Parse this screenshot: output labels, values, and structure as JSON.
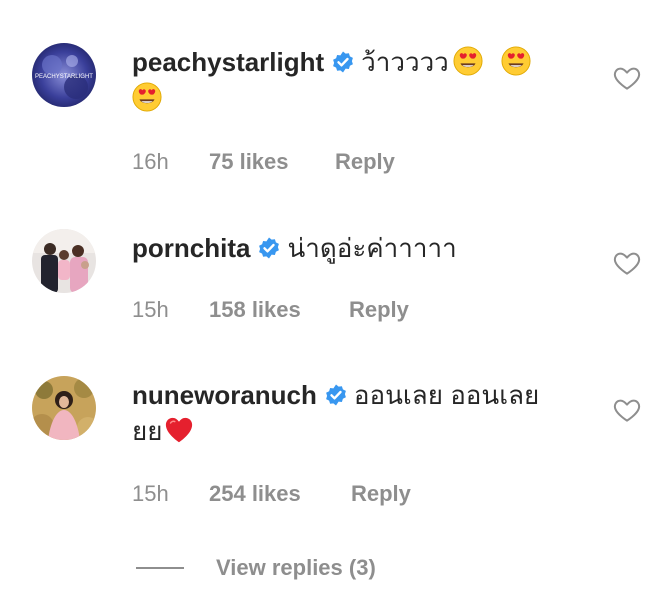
{
  "comments": [
    {
      "username": "peachystarlight",
      "text": "ว้าวววว",
      "emojis": [
        "heart-eyes",
        "heart-eyes",
        "heart-eyes"
      ],
      "avatar_text": "PEACHYSTARLIGHT",
      "time": "16h",
      "likes": "75 likes",
      "reply": "Reply"
    },
    {
      "username": "pornchita",
      "text": "น่าดูอ่ะค่าาาาา",
      "emojis": [],
      "time": "15h",
      "likes": "158 likes",
      "reply": "Reply"
    },
    {
      "username": "nuneworanuch",
      "text": "ออนเลย ออนเลย",
      "text_line2": "ยย",
      "emojis": [
        "red-heart"
      ],
      "time": "15h",
      "likes": "254 likes",
      "reply": "Reply"
    }
  ],
  "view_replies": "View replies (3)",
  "colors": {
    "text": "#262626",
    "muted": "#8e8e8e",
    "verified": "#3897f0",
    "heart": "#e5202e"
  }
}
